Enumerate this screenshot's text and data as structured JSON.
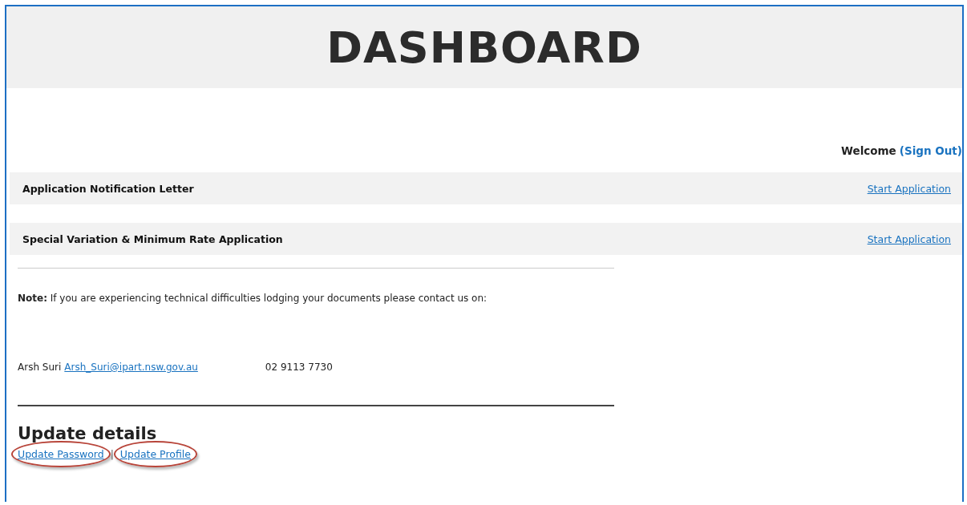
{
  "header": {
    "title": "DASHBOARD"
  },
  "welcome": {
    "text": "Welcome",
    "link": "(Sign Out)"
  },
  "applications": [
    {
      "name": "Application Notification Letter",
      "action": "Start Application"
    },
    {
      "name": "Special Variation & Minimum Rate Application",
      "action": "Start Application"
    }
  ],
  "note": {
    "text": "**Note:** If you are experiencing technical difficulties lodging your documents please contact us on:"
  },
  "contact": {
    "name": "Arsh Suri",
    "email": "Arsh_Suri@ipart.nsw.gov.au",
    "phone": "02 9113 7730"
  },
  "update": {
    "heading": "Update details",
    "separator": "|",
    "links": [
      {
        "label": "Update Password",
        "circled": true
      },
      {
        "label": "Update Profile",
        "circled": true
      }
    ]
  }
}
